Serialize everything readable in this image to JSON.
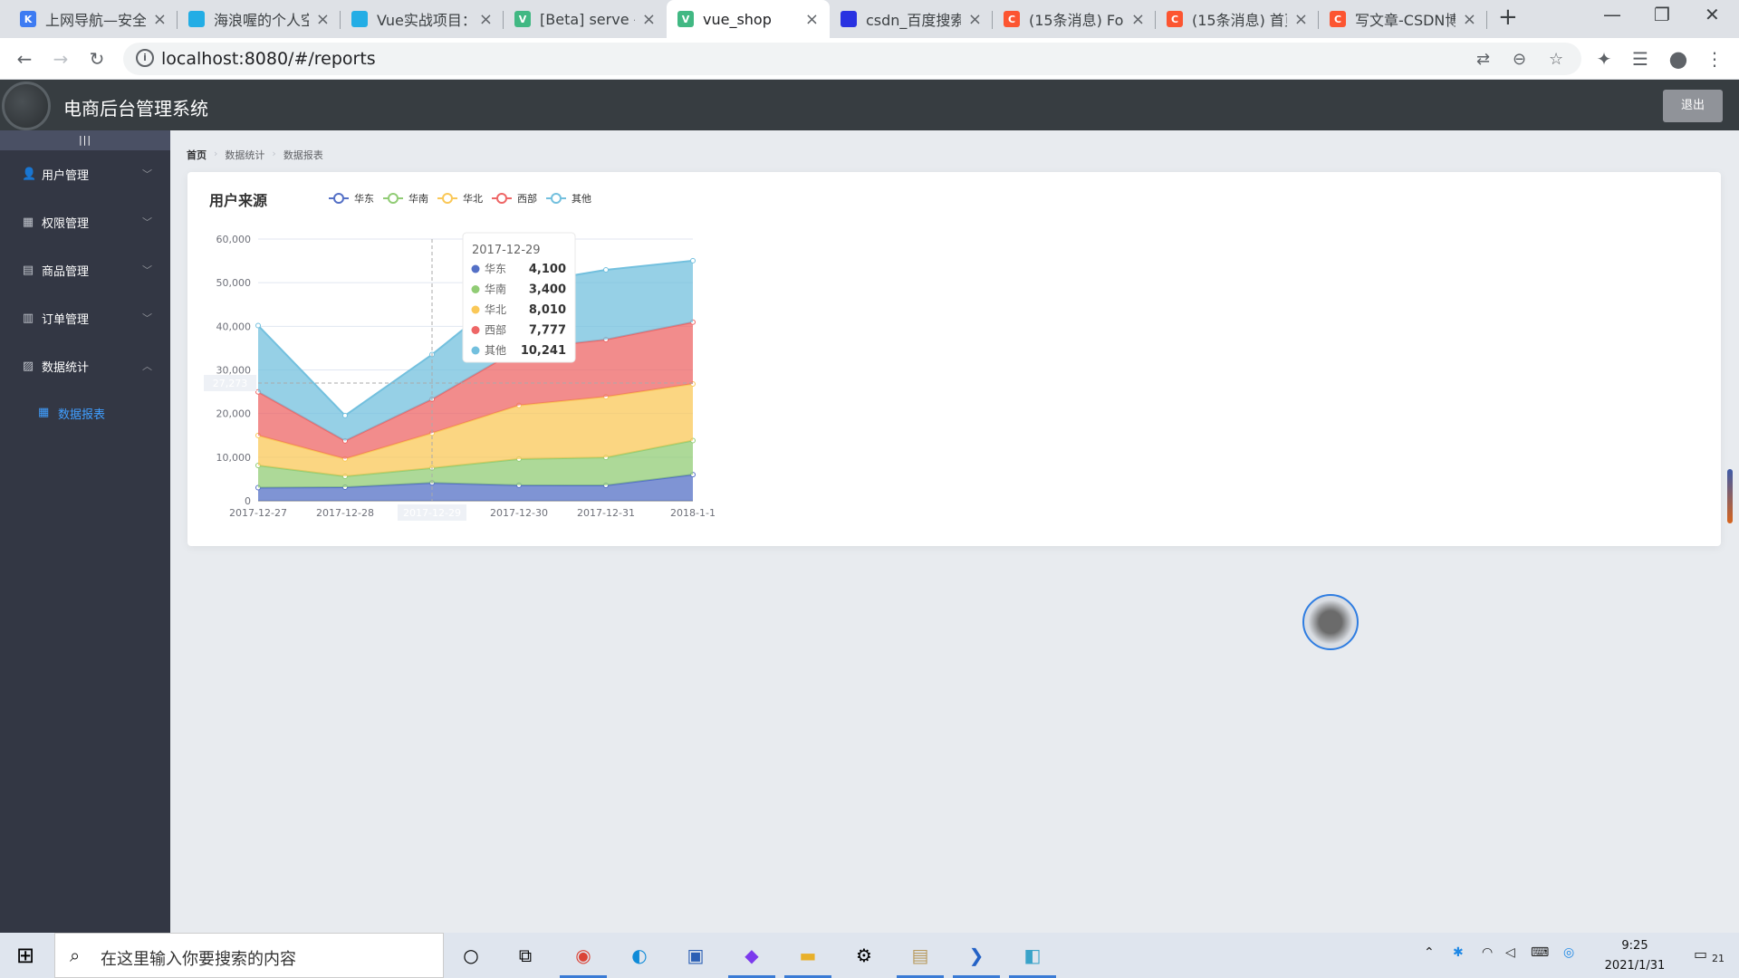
{
  "browser": {
    "tabs": [
      {
        "label": "上网导航—安全",
        "favicon": "K",
        "color": "#3d7bf2"
      },
      {
        "label": "海浪喔的个人空",
        "favicon": "bili",
        "color": "#23ade5"
      },
      {
        "label": "Vue实战项目：",
        "favicon": "bili",
        "color": "#23ade5"
      },
      {
        "label": "[Beta] serve -",
        "favicon": "V",
        "color": "#41b883"
      },
      {
        "label": "vue_shop",
        "favicon": "V",
        "color": "#41b883"
      },
      {
        "label": "csdn_百度搜索",
        "favicon": "paw",
        "color": "#2932e1"
      },
      {
        "label": "(15条消息) For",
        "favicon": "C",
        "color": "#fc5531"
      },
      {
        "label": "(15条消息) 首页",
        "favicon": "C",
        "color": "#fc5531"
      },
      {
        "label": "写文章-CSDN博",
        "favicon": "C",
        "color": "#fc5531"
      }
    ],
    "active_tab": 4,
    "url": "localhost:8080/#/reports"
  },
  "header": {
    "title": "电商后台管理系统",
    "logout_label": "退出"
  },
  "sidebar": {
    "toggle_label": "|||",
    "items": [
      {
        "label": "用户管理",
        "icon": "user-icon",
        "expanded": false
      },
      {
        "label": "权限管理",
        "icon": "grid-icon",
        "expanded": false
      },
      {
        "label": "商品管理",
        "icon": "box-icon",
        "expanded": false
      },
      {
        "label": "订单管理",
        "icon": "clipboard-icon",
        "expanded": false
      },
      {
        "label": "数据统计",
        "icon": "chart-icon",
        "expanded": true
      }
    ],
    "subitem": {
      "label": "数据报表",
      "icon": "grid-icon"
    }
  },
  "breadcrumb": [
    "首页",
    "数据统计",
    "数据报表"
  ],
  "chart_data": {
    "type": "area",
    "stacked": true,
    "title": "用户来源",
    "x": [
      "2017-12-27",
      "2017-12-28",
      "2017-12-29",
      "2017-12-30",
      "2017-12-31",
      "2018-1-1"
    ],
    "ylim": [
      0,
      60000
    ],
    "yticks": [
      "0",
      "10,000",
      "20,000",
      "30,000",
      "40,000",
      "50,000",
      "60,000"
    ],
    "legend_position": "top",
    "grid": true,
    "series": [
      {
        "name": "华东",
        "color": "#5470c6",
        "values": [
          2999,
          3111,
          4100,
          3565,
          3528,
          6000
        ]
      },
      {
        "name": "华南",
        "color": "#91cc75",
        "values": [
          5090,
          2500,
          3400,
          6000,
          6400,
          7800
        ]
      },
      {
        "name": "华北",
        "color": "#fac858",
        "values": [
          6888,
          4000,
          8010,
          12321,
          13928,
          12984
        ]
      },
      {
        "name": "西部",
        "color": "#ee6666",
        "values": [
          9991,
          4130,
          7777,
          12903,
          13098,
          14161
        ]
      },
      {
        "name": "其他",
        "color": "#73c0de",
        "values": [
          15212,
          5800,
          10241,
          14821,
          15982,
          14091
        ]
      }
    ],
    "tooltip": {
      "x": "2017-12-29",
      "axis_pointer_y_label": "27,273"
    }
  },
  "taskbar": {
    "search_placeholder": "在这里输入你要搜索的内容",
    "time": "9:25",
    "date": "2021/1/31",
    "notification_count": "21"
  }
}
